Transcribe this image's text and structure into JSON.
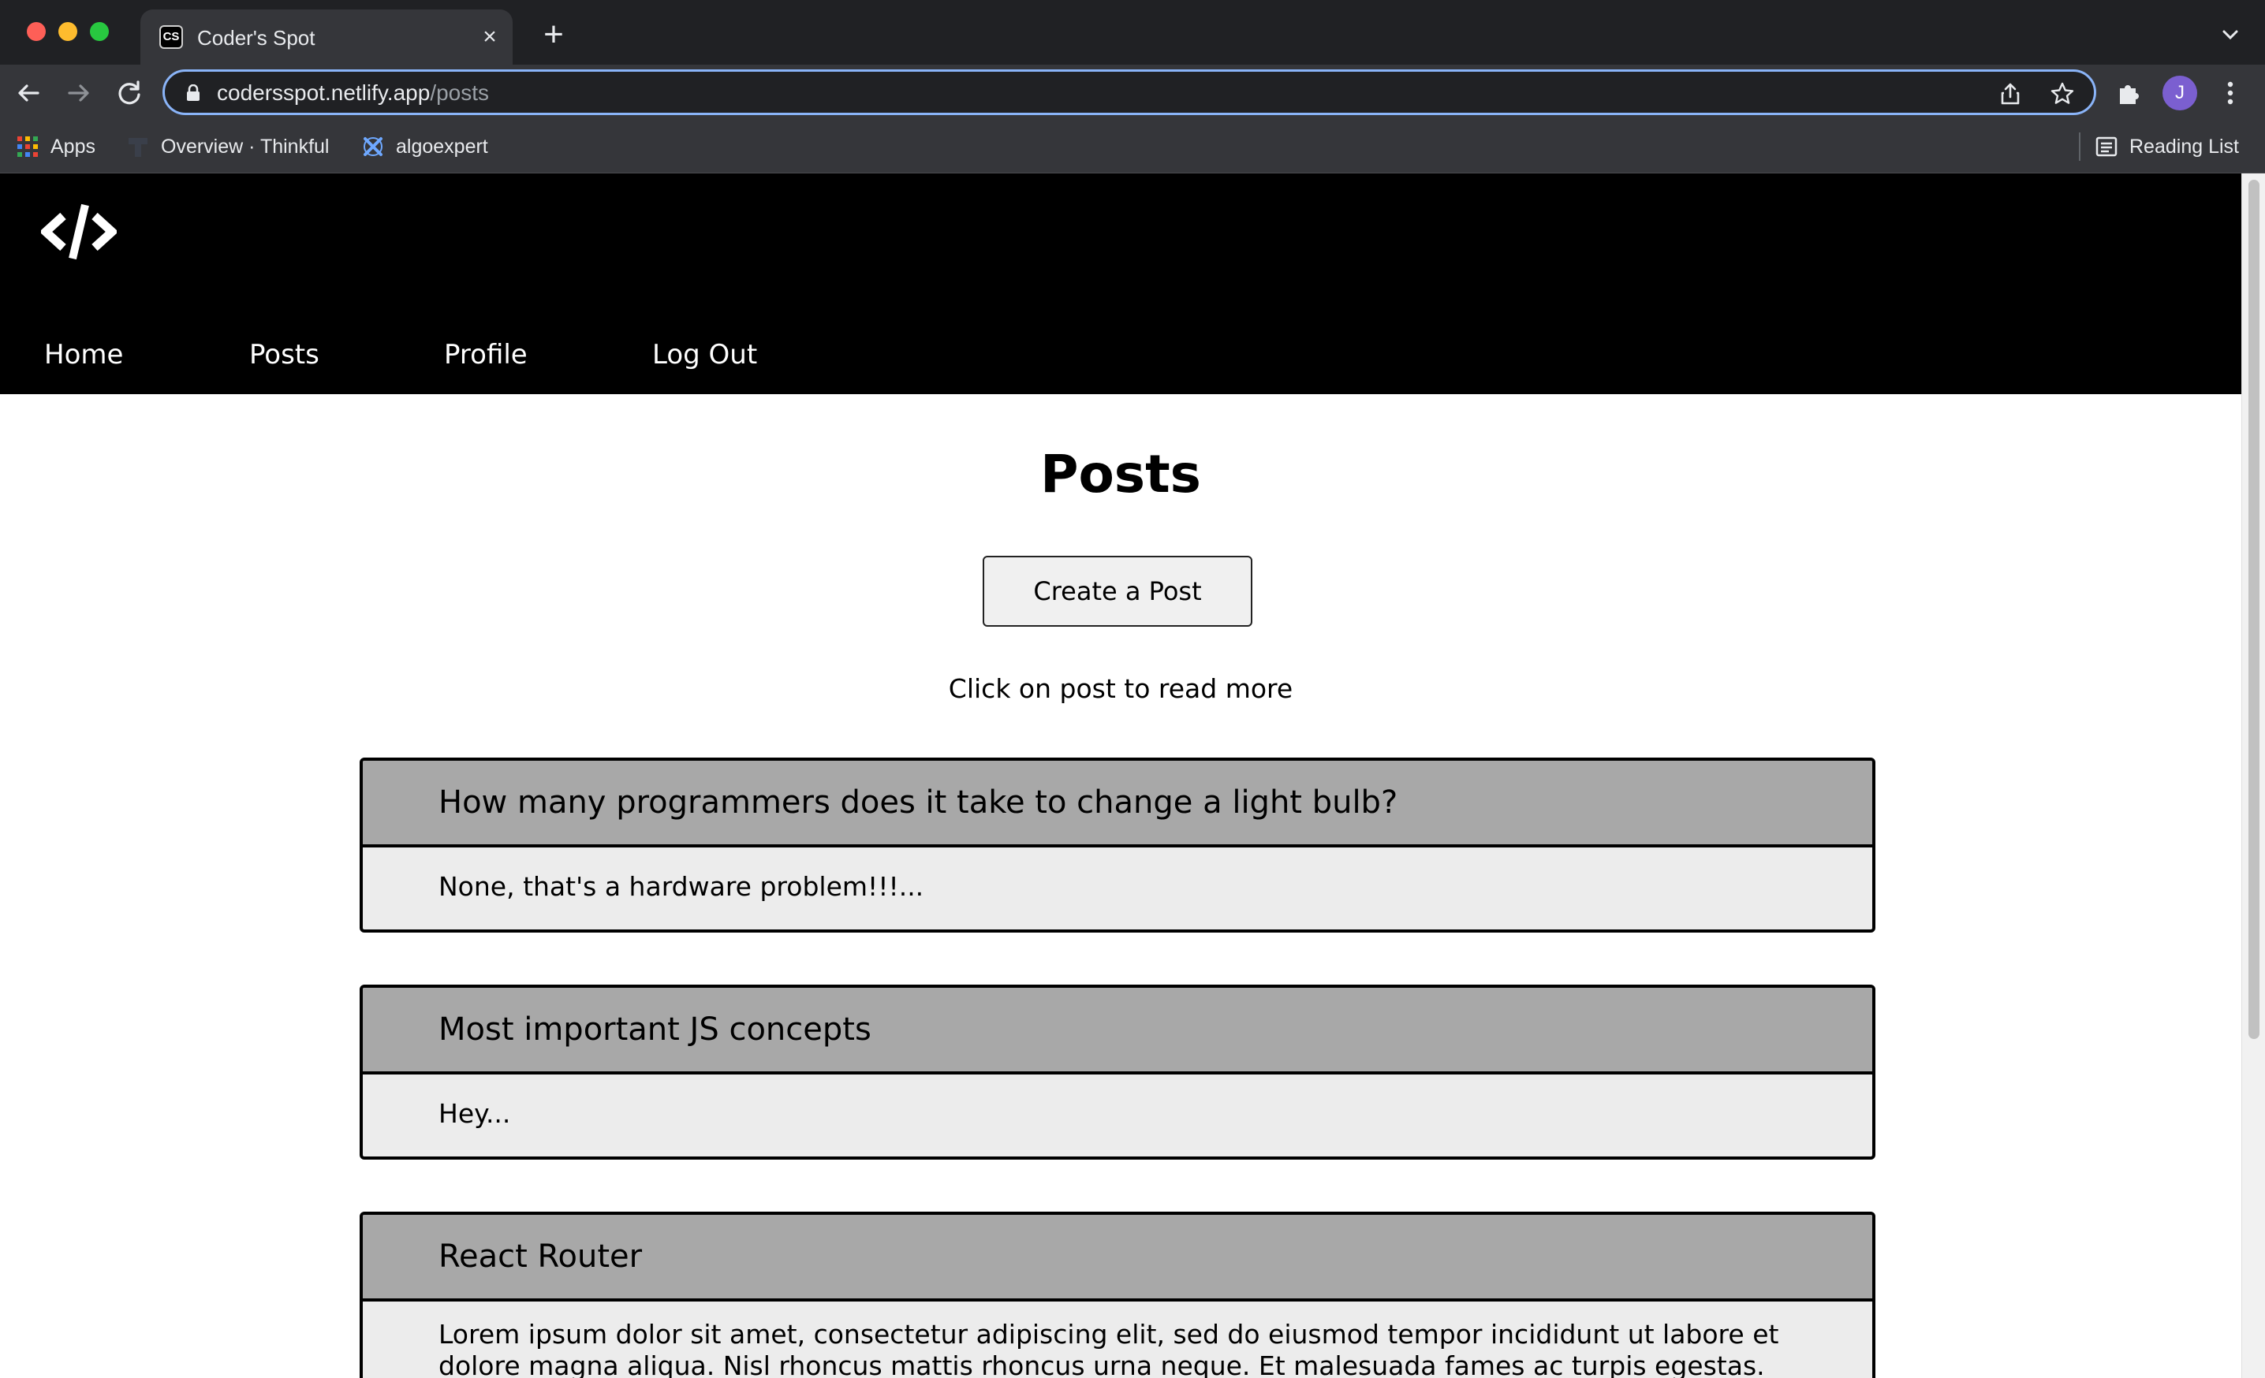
{
  "browser": {
    "tab_title": "Coder's Spot",
    "tab_favicon_text": "CS",
    "url_host": "codersspot.netlify.app",
    "url_path": "/posts",
    "profile_initial": "J",
    "bookmarks": [
      {
        "label": "Apps",
        "icon": "apps-grid-icon"
      },
      {
        "label": "Overview · Thinkful",
        "icon": "thinkful-icon"
      },
      {
        "label": "algoexpert",
        "icon": "algoexpert-icon"
      }
    ],
    "reading_list_label": "Reading List"
  },
  "site": {
    "logo_icon": "code-brackets-icon",
    "nav": [
      {
        "label": "Home"
      },
      {
        "label": "Posts"
      },
      {
        "label": "Profile"
      },
      {
        "label": "Log Out"
      }
    ]
  },
  "main": {
    "title": "Posts",
    "create_button_label": "Create a Post",
    "hint": "Click on post to read more",
    "posts": [
      {
        "title": "How many programmers does it take to change a light bulb?",
        "excerpt": "None, that's a hardware problem!!!..."
      },
      {
        "title": "Most important JS concepts",
        "excerpt": "Hey..."
      },
      {
        "title": "React Router",
        "excerpt": "Lorem ipsum dolor sit amet, consectetur adipiscing elit, sed do eiusmod tempor incididunt ut labore et dolore magna aliqua. Nisl rhoncus mattis rhoncus urna neque. Et malesuada fames ac turpis egestas."
      }
    ]
  },
  "colors": {
    "header_bg": "#000000",
    "post_header_bg": "#a8a8a8",
    "post_body_bg": "#ececec",
    "omnibox_focus": "#8ab4f8"
  }
}
